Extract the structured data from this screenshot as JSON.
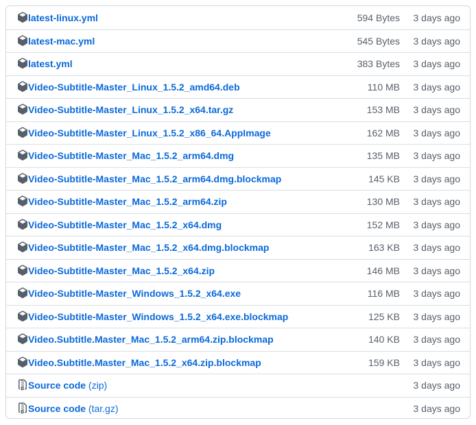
{
  "assets": [
    {
      "name": "latest-linux.yml",
      "size": "594 Bytes",
      "date": "3 days ago",
      "icon": "package-icon"
    },
    {
      "name": "latest-mac.yml",
      "size": "545 Bytes",
      "date": "3 days ago",
      "icon": "package-icon"
    },
    {
      "name": "latest.yml",
      "size": "383 Bytes",
      "date": "3 days ago",
      "icon": "package-icon"
    },
    {
      "name": "Video-Subtitle-Master_Linux_1.5.2_amd64.deb",
      "size": "110 MB",
      "date": "3 days ago",
      "icon": "package-icon"
    },
    {
      "name": "Video-Subtitle-Master_Linux_1.5.2_x64.tar.gz",
      "size": "153 MB",
      "date": "3 days ago",
      "icon": "package-icon"
    },
    {
      "name": "Video-Subtitle-Master_Linux_1.5.2_x86_64.AppImage",
      "size": "162 MB",
      "date": "3 days ago",
      "icon": "package-icon"
    },
    {
      "name": "Video-Subtitle-Master_Mac_1.5.2_arm64.dmg",
      "size": "135 MB",
      "date": "3 days ago",
      "icon": "package-icon"
    },
    {
      "name": "Video-Subtitle-Master_Mac_1.5.2_arm64.dmg.blockmap",
      "size": "145 KB",
      "date": "3 days ago",
      "icon": "package-icon"
    },
    {
      "name": "Video-Subtitle-Master_Mac_1.5.2_arm64.zip",
      "size": "130 MB",
      "date": "3 days ago",
      "icon": "package-icon"
    },
    {
      "name": "Video-Subtitle-Master_Mac_1.5.2_x64.dmg",
      "size": "152 MB",
      "date": "3 days ago",
      "icon": "package-icon"
    },
    {
      "name": "Video-Subtitle-Master_Mac_1.5.2_x64.dmg.blockmap",
      "size": "163 KB",
      "date": "3 days ago",
      "icon": "package-icon"
    },
    {
      "name": "Video-Subtitle-Master_Mac_1.5.2_x64.zip",
      "size": "146 MB",
      "date": "3 days ago",
      "icon": "package-icon"
    },
    {
      "name": "Video-Subtitle-Master_Windows_1.5.2_x64.exe",
      "size": "116 MB",
      "date": "3 days ago",
      "icon": "package-icon"
    },
    {
      "name": "Video-Subtitle-Master_Windows_1.5.2_x64.exe.blockmap",
      "size": "125 KB",
      "date": "3 days ago",
      "icon": "package-icon"
    },
    {
      "name": "Video.Subtitle.Master_Mac_1.5.2_arm64.zip.blockmap",
      "size": "140 KB",
      "date": "3 days ago",
      "icon": "package-icon"
    },
    {
      "name": "Video.Subtitle.Master_Mac_1.5.2_x64.zip.blockmap",
      "size": "159 KB",
      "date": "3 days ago",
      "icon": "package-icon"
    }
  ],
  "source_code": [
    {
      "label": "Source code",
      "suffix": "(zip)",
      "date": "3 days ago",
      "icon": "file-zip-icon"
    },
    {
      "label": "Source code",
      "suffix": "(tar.gz)",
      "date": "3 days ago",
      "icon": "file-zip-icon"
    }
  ],
  "colors": {
    "link": "#0969da",
    "muted": "#57606a",
    "border": "#d0d7de"
  }
}
